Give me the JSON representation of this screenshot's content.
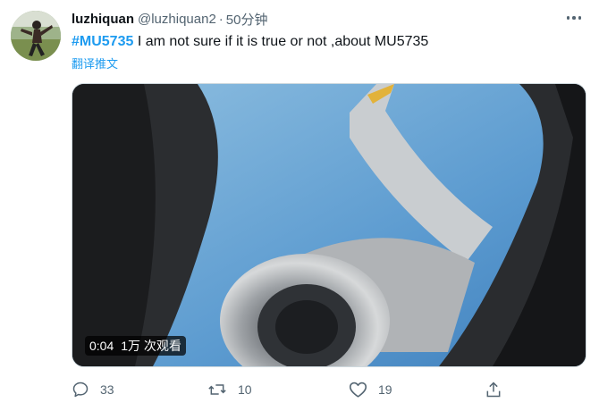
{
  "tweet": {
    "name": "luzhiquan",
    "handle": "@luzhiquan2",
    "separator": "·",
    "time": "50分钟",
    "hashtag": "#MU5735",
    "body_text": " I am not sure if it is true or not ,about MU5735",
    "translate_label": "翻译推文"
  },
  "video": {
    "duration": "0:04",
    "views": "1万 次观看"
  },
  "actions": {
    "replies": "33",
    "retweets": "10",
    "likes": "19"
  },
  "icons": {
    "more": "more-dots-icon",
    "reply": "reply-bubble-icon",
    "retweet": "retweet-icon",
    "like": "heart-icon",
    "share": "share-upload-icon"
  },
  "colors": {
    "accent": "#1d9bf0",
    "text_primary": "#0f1419",
    "text_secondary": "#536471"
  }
}
